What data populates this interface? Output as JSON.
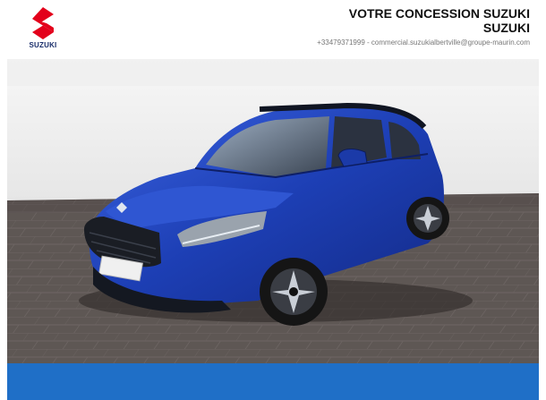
{
  "brand": {
    "logo_text": "SUZUKI",
    "logo_color": "#e3001b",
    "text_color": "#1a2e6b"
  },
  "dealer": {
    "title_line1": "VOTRE CONCESSION SUZUKI",
    "title_line2": "SUZUKI",
    "phone": "+33479371999",
    "separator": "-",
    "email": "commercial.suzukialbertville@groupe-maurin.com"
  },
  "photo": {
    "subject": "car-photo",
    "car_color": "#1d3fb5",
    "floor_color": "#5e5754"
  },
  "footer": {
    "bar_color": "#1f6fc7"
  }
}
